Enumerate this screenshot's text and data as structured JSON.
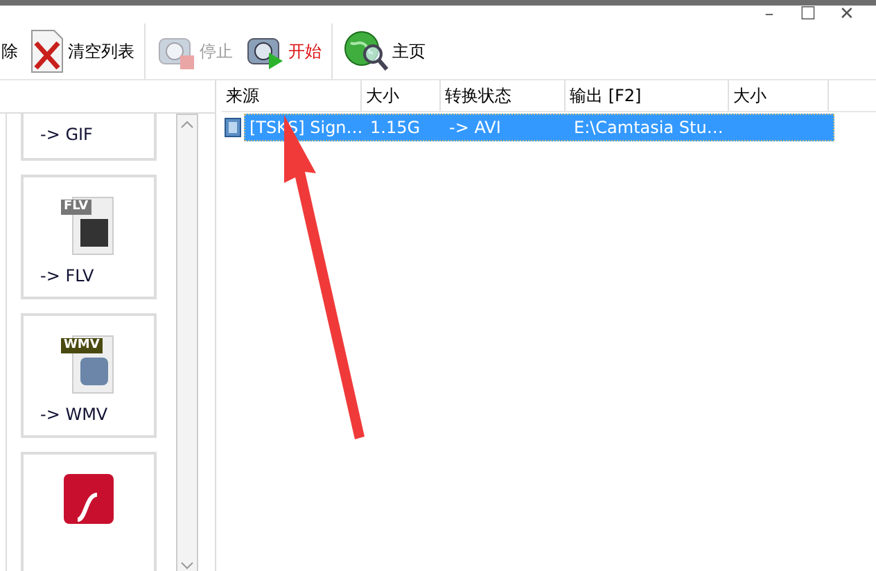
{
  "window_controls": [
    "–",
    "☐",
    "✕"
  ],
  "toolbar": [
    {
      "kind": "remove",
      "label": "除",
      "disabled": false,
      "active": false
    },
    {
      "kind": "clear",
      "label": "清空列表",
      "disabled": false,
      "active": false
    },
    {
      "kind": "stop",
      "label": "停止",
      "disabled": true,
      "active": false
    },
    {
      "kind": "start",
      "label": "开始",
      "disabled": false,
      "active": true
    },
    {
      "kind": "home",
      "label": "主页",
      "disabled": false,
      "active": false
    }
  ],
  "formats": [
    {
      "kind": "gif",
      "label": "-> GIF"
    },
    {
      "kind": "flv",
      "badge": "FLV",
      "label": "-> FLV"
    },
    {
      "kind": "wmv",
      "badge": "WMV",
      "label": "-> WMV"
    },
    {
      "kind": "flash"
    }
  ],
  "table": {
    "columns": [
      "来源",
      "大小",
      "转换状态",
      "输出 [F2]",
      "大小"
    ],
    "rows": [
      {
        "selected": true,
        "cells": [
          "[TSKS] Sign…",
          "1.15G",
          "-> AVI",
          "E:\\Camtasia Stu…",
          ""
        ]
      }
    ]
  }
}
